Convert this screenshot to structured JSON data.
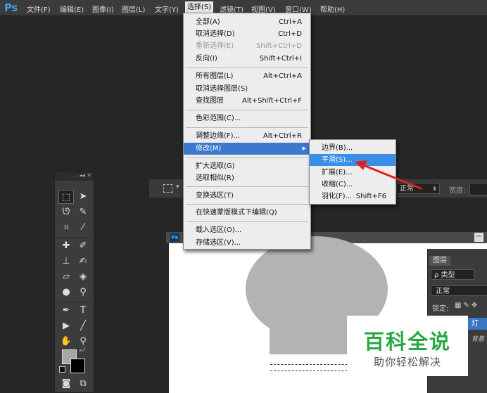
{
  "app": {
    "logo": "Ps"
  },
  "menubar": {
    "items": [
      "文件(F)",
      "编辑(E)",
      "图像(I)",
      "图层(L)",
      "文字(Y)",
      "选择(S)",
      "滤镜(T)",
      "视图(V)",
      "窗口(W)",
      "帮助(H)"
    ],
    "active": "选择(S)"
  },
  "select_menu": {
    "items": [
      {
        "label": "全部(A)",
        "shortcut": "Ctrl+A"
      },
      {
        "label": "取消选择(D)",
        "shortcut": "Ctrl+D"
      },
      {
        "label": "重新选择(E)",
        "shortcut": "Shift+Ctrl+D",
        "disabled": true
      },
      {
        "label": "反向(I)",
        "shortcut": "Shift+Ctrl+I"
      },
      {
        "label": "所有图层(L)",
        "shortcut": "Alt+Ctrl+A"
      },
      {
        "label": "取消选择图层(S)",
        "shortcut": ""
      },
      {
        "label": "查找图层",
        "shortcut": "Alt+Shift+Ctrl+F"
      },
      {
        "label": "色彩范围(C)...",
        "shortcut": ""
      },
      {
        "label": "调整边缘(F)...",
        "shortcut": "Alt+Ctrl+R"
      },
      {
        "label": "修改(M)",
        "shortcut": "",
        "highlighted": true
      },
      {
        "label": "扩大选取(G)",
        "shortcut": ""
      },
      {
        "label": "选取相似(R)",
        "shortcut": ""
      },
      {
        "label": "变换选区(T)",
        "shortcut": ""
      },
      {
        "label": "在快速蒙版模式下编辑(Q)",
        "shortcut": ""
      },
      {
        "label": "载入选区(O)...",
        "shortcut": ""
      },
      {
        "label": "存储选区(V)...",
        "shortcut": ""
      }
    ]
  },
  "modify_submenu": {
    "items": [
      {
        "label": "边界(B)...",
        "shortcut": ""
      },
      {
        "label": "平滑(S)...",
        "shortcut": "",
        "highlighted": true
      },
      {
        "label": "扩展(E)...",
        "shortcut": ""
      },
      {
        "label": "收缩(C)...",
        "shortcut": ""
      },
      {
        "label": "羽化(F)...",
        "shortcut": "Shift+F6"
      }
    ]
  },
  "options_bar": {
    "mode": "正常",
    "width_label": "宽度:"
  },
  "layers_panel": {
    "tab": "图层",
    "kind_filter": "ρ 类型",
    "blend_mode": "正常",
    "lock_label": "锁定:",
    "layer_name": "灯",
    "background_layer": "背景"
  },
  "doc": {
    "icon": "Ps"
  },
  "watermark": {
    "title": "百科全说",
    "subtitle": "助你轻松解决"
  },
  "colors": {
    "accent": "#3b78ce",
    "menu_bg": "#ededed",
    "arrow": "#e02020",
    "watermark_green": "#28a745"
  },
  "icons": {
    "close": "close-icon",
    "swap": "swap-colors-icon"
  }
}
